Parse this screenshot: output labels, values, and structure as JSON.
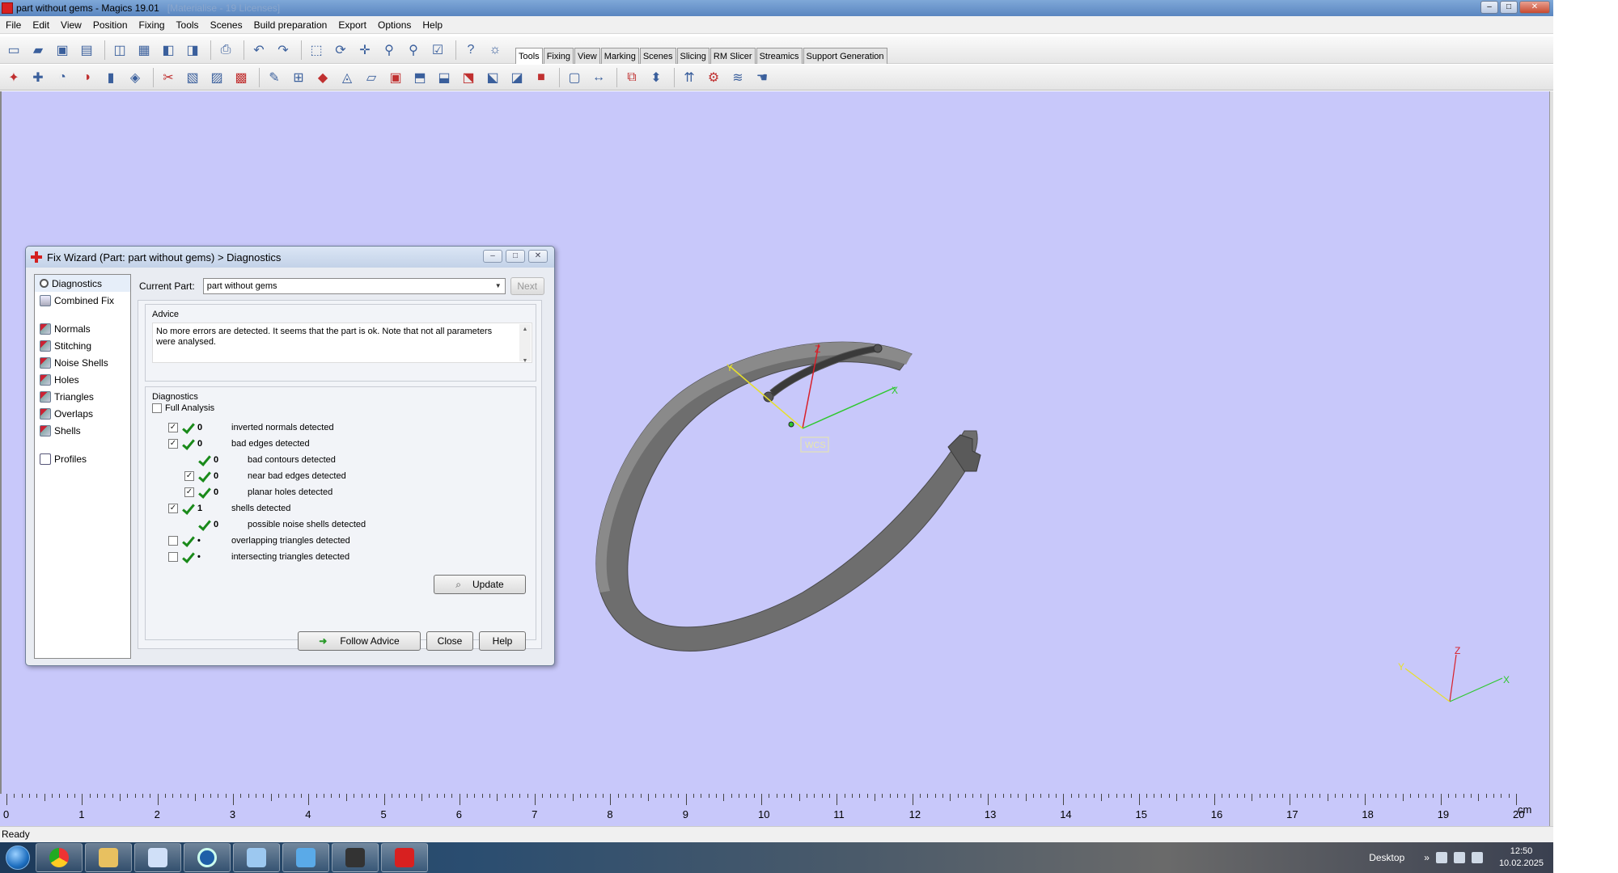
{
  "window": {
    "title": "part without gems - Magics 19.01",
    "ghost_text": "[Materialise - 19 Licenses]",
    "controls": [
      "minimize",
      "maximize",
      "close"
    ]
  },
  "menu": [
    "File",
    "Edit",
    "View",
    "Position",
    "Fixing",
    "Tools",
    "Scenes",
    "Build preparation",
    "Export",
    "Options",
    "Help"
  ],
  "toolbar_tabs": [
    {
      "label": "Tools",
      "active": true
    },
    {
      "label": "Fixing",
      "active": false
    },
    {
      "label": "View",
      "active": false
    },
    {
      "label": "Marking",
      "active": false
    },
    {
      "label": "Scenes",
      "active": false
    },
    {
      "label": "Slicing",
      "active": false
    },
    {
      "label": "RM Slicer",
      "active": false
    },
    {
      "label": "Streamics",
      "active": false
    },
    {
      "label": "Support Generation",
      "active": false
    }
  ],
  "toolbar1_icons": [
    "new-file-icon",
    "open-folder-icon",
    "save-icon",
    "save-as-icon",
    "import-part-icon",
    "save-part-icon",
    "load-icon",
    "unload-icon",
    "print-icon",
    "undo-icon",
    "redo-icon",
    "select-icon",
    "rotate-icon",
    "pan-icon",
    "zoom-icon",
    "zoom-window-icon",
    "check-icon",
    "help-icon",
    "help-context-icon"
  ],
  "toolbar2_icons": [
    "translate-icon",
    "move-icon",
    "rotate-part-icon",
    "mirror-icon",
    "scale-icon",
    "duplicate-icon",
    "cut-icon",
    "hollow-icon",
    "offset-icon",
    "boolean-icon",
    "label-icon",
    "measure-icon",
    "mark-icon",
    "triangle-icon",
    "section-icon",
    "box-icon",
    "top-view-icon",
    "front-view-icon",
    "side-view-icon",
    "iso-view-icon",
    "wireframe-icon",
    "shaded-icon",
    "transparent-icon",
    "split-icon",
    "nest-icon",
    "platform-icon",
    "support-icon",
    "settings-icon",
    "layers-icon",
    "hand-icon"
  ],
  "colors": {
    "viewport_bg": "#c8c8fa",
    "part_gray": "#6e6e6e",
    "axis_x": "#2ec82e",
    "axis_y": "#e8e02a",
    "axis_z": "#d8202a",
    "check_green": "#1a8a1a"
  },
  "scene": {
    "wcs_label": "WCS",
    "axes": {
      "x": "X",
      "y": "Y",
      "z": "Z"
    },
    "mini_axes": {
      "x": "X",
      "y": "Y",
      "z": "Z"
    }
  },
  "ruler": {
    "labels": [
      "0",
      "1",
      "2",
      "3",
      "4",
      "5",
      "6",
      "7",
      "8",
      "9",
      "10",
      "11",
      "12",
      "13",
      "14",
      "15",
      "16",
      "17",
      "18",
      "19",
      "20"
    ],
    "unit": "cm"
  },
  "status": {
    "text": "Ready"
  },
  "taskbar": {
    "apps": [
      "start-button",
      "chrome-app",
      "explorer-app",
      "paint-app",
      "settings-app",
      "document-app",
      "vs-app",
      "tool-app",
      "magics-app"
    ],
    "desktop_label": "Desktop",
    "chevron": "»",
    "time": "12:50",
    "date": "10.02.2025"
  },
  "dialog": {
    "title": "Fix Wizard (Part: part without gems) > Diagnostics",
    "nav_top": [
      {
        "label": "Diagnostics",
        "icon": "magnifier-icon",
        "active": true
      },
      {
        "label": "Combined Fix",
        "icon": "combined-fix-icon",
        "active": false
      }
    ],
    "nav_tools": [
      {
        "label": "Normals",
        "icon": "normals-icon"
      },
      {
        "label": "Stitching",
        "icon": "stitching-icon"
      },
      {
        "label": "Noise Shells",
        "icon": "noise-shells-icon"
      },
      {
        "label": "Holes",
        "icon": "holes-icon"
      },
      {
        "label": "Triangles",
        "icon": "triangles-icon"
      },
      {
        "label": "Overlaps",
        "icon": "overlaps-icon"
      },
      {
        "label": "Shells",
        "icon": "shells-icon"
      }
    ],
    "nav_bottom": [
      {
        "label": "Profiles",
        "icon": "profiles-icon"
      }
    ],
    "current_part_label": "Current Part:",
    "current_part_value": "part without gems",
    "next_label": "Next",
    "advice_label": "Advice",
    "advice_text": "No more errors are detected. It seems that the part is ok. Note that not all parameters were analysed.",
    "diagnostics_label": "Diagnostics",
    "full_analysis_label": "Full Analysis",
    "full_analysis_checked": false,
    "rows": [
      {
        "indent": 0,
        "checkbox": true,
        "checked": true,
        "status": "ok",
        "count": "0",
        "label": "inverted normals detected"
      },
      {
        "indent": 0,
        "checkbox": true,
        "checked": true,
        "status": "ok",
        "count": "0",
        "label": "bad edges detected"
      },
      {
        "indent": 1,
        "checkbox": false,
        "checked": false,
        "status": "ok",
        "count": "0",
        "label": "bad contours detected"
      },
      {
        "indent": 1,
        "checkbox": true,
        "checked": true,
        "status": "ok",
        "count": "0",
        "label": "near bad edges detected"
      },
      {
        "indent": 1,
        "checkbox": true,
        "checked": true,
        "status": "ok",
        "count": "0",
        "label": "planar holes detected"
      },
      {
        "indent": 0,
        "checkbox": true,
        "checked": true,
        "status": "ok",
        "count": "1",
        "label": "shells detected"
      },
      {
        "indent": 1,
        "checkbox": false,
        "checked": false,
        "status": "ok",
        "count": "0",
        "label": "possible noise shells detected"
      },
      {
        "indent": 0,
        "checkbox": true,
        "checked": false,
        "status": "unknown",
        "count": "•",
        "label": "overlapping triangles detected"
      },
      {
        "indent": 0,
        "checkbox": true,
        "checked": false,
        "status": "unknown",
        "count": "•",
        "label": "intersecting triangles detected"
      }
    ],
    "update_label": "Update",
    "follow_advice_label": "Follow Advice",
    "close_label": "Close",
    "help_label": "Help"
  }
}
